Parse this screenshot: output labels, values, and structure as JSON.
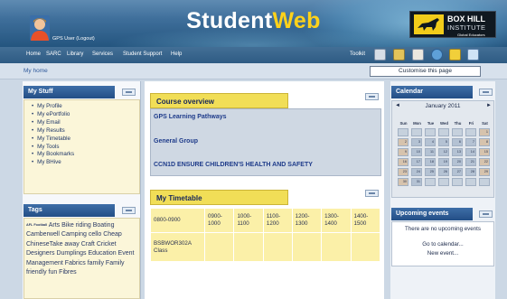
{
  "header": {
    "user_text": "GPS User (Logout)",
    "brand_part1": "Student",
    "brand_part2": "Web",
    "logo_line1": "BOX HILL",
    "logo_line2": "INSTITUTE",
    "logo_tagline": "Global Educators"
  },
  "nav": {
    "items": [
      "Home",
      "SARC",
      "Library",
      "Services",
      "Student Support",
      "Help"
    ],
    "toolkit_label": "Toolkit",
    "toolkit_icons": [
      "notebook-icon",
      "pen-icon",
      "document-icon",
      "globe-icon",
      "pencil-icon",
      "calendar-icon"
    ]
  },
  "breadcrumb": {
    "label": "My home"
  },
  "customise_button": "Customise this page",
  "my_stuff": {
    "title": "My Stuff",
    "items": [
      "My Profile",
      "My ePortfolio",
      "My Email",
      "My Results",
      "My Timetable",
      "My Tools",
      "My Bookmarks",
      "My BHive"
    ]
  },
  "tags": {
    "title": "Tags",
    "first_tag": "AFL Football",
    "text": "Arts Bike riding Boating Camberwell Camping cello Cheap ChineseTake away Craft Cricket Designers Dumplings Education Event Management Fabrics family Family friendly fun Fibres"
  },
  "course_overview": {
    "title": "Course overview",
    "links": [
      "GPS Learning Pathways",
      "General Group",
      "CCN1D ENSURE CHILDREN'S HEALTH AND SAFETY"
    ]
  },
  "timetable": {
    "title": "My Timetable",
    "header_row": [
      "0800-0900",
      "0900-\n1000",
      "1000-\n1100",
      "1100-\n1200",
      "1200-\n1300",
      "1300-\n1400",
      "1400-\n1500"
    ],
    "row_label": "BSBWOR302A Class"
  },
  "calendar": {
    "title": "Calendar",
    "month": "January 2011",
    "prev": "◄",
    "next": "►",
    "days_of_week": [
      "Sun",
      "Mon",
      "Tue",
      "Wed",
      "Thu",
      "Fri",
      "Sat"
    ],
    "weeks": [
      [
        "",
        "",
        "",
        "",
        "",
        "",
        "1"
      ],
      [
        "2",
        "3",
        "4",
        "5",
        "6",
        "7",
        "8"
      ],
      [
        "9",
        "10",
        "11",
        "12",
        "13",
        "14",
        "15"
      ],
      [
        "16",
        "17",
        "18",
        "19",
        "20",
        "21",
        "22"
      ],
      [
        "23",
        "24",
        "25",
        "26",
        "27",
        "28",
        "29"
      ],
      [
        "30",
        "31",
        "",
        "",
        "",
        "",
        ""
      ]
    ]
  },
  "upcoming_events": {
    "title": "Upcoming events",
    "empty_text": "There are no upcoming events",
    "goto_link": "Go to calendar...",
    "new_event_link": "New event..."
  },
  "colors": {
    "brand_yellow": "#ffd21a",
    "block_header_blue": "#234e86",
    "course_header_yellow": "#f1de57"
  }
}
